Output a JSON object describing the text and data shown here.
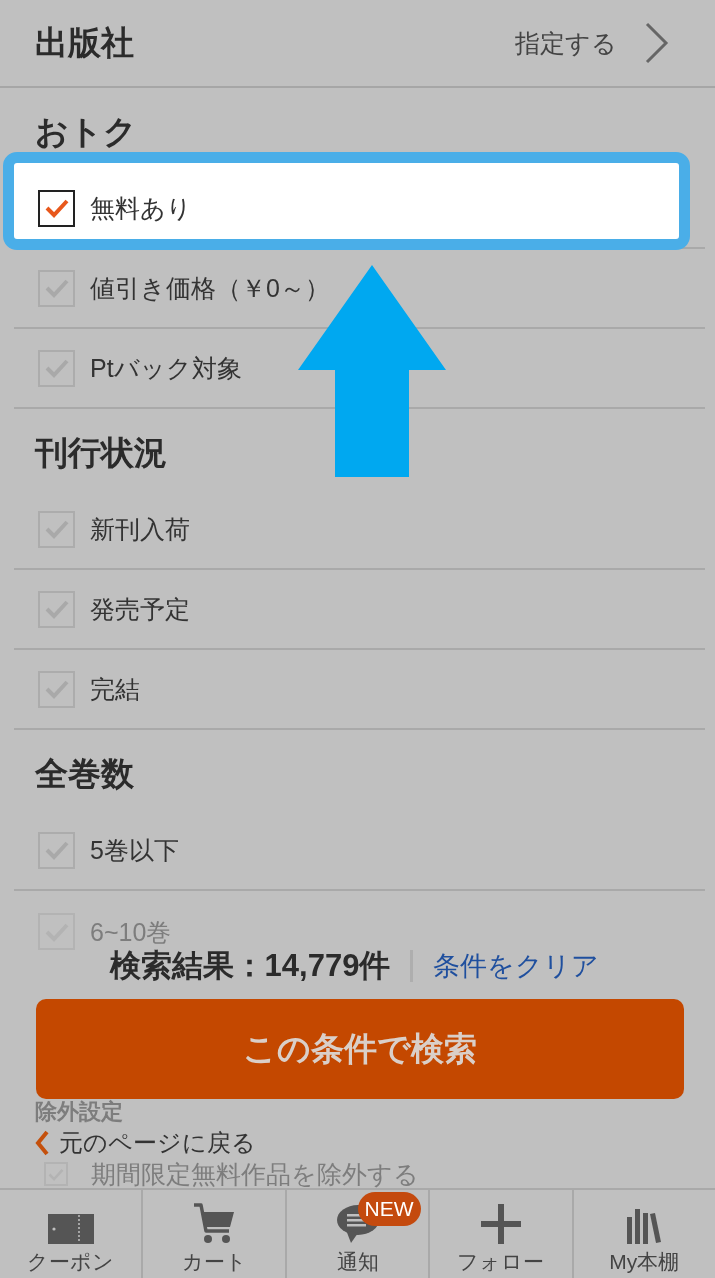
{
  "publisher_row": {
    "label": "出版社",
    "action": "指定する"
  },
  "sections": [
    {
      "heading": "おトク",
      "faded": false,
      "options": [
        {
          "label": "無料あり",
          "checked": true,
          "highlighted": true,
          "faded": false
        },
        {
          "label": "値引き価格（￥0～）",
          "checked": false,
          "highlighted": false,
          "faded": false
        },
        {
          "label": "Ptバック対象",
          "checked": false,
          "highlighted": false,
          "faded": false
        }
      ]
    },
    {
      "heading": "刊行状況",
      "faded": false,
      "options": [
        {
          "label": "新刊入荷",
          "checked": false,
          "highlighted": false,
          "faded": false
        },
        {
          "label": "発売予定",
          "checked": false,
          "highlighted": false,
          "faded": false
        },
        {
          "label": "完結",
          "checked": false,
          "highlighted": false,
          "faded": false
        }
      ]
    },
    {
      "heading": "全巻数",
      "faded": false,
      "options": [
        {
          "label": "5巻以下",
          "checked": false,
          "highlighted": false,
          "faded": false
        },
        {
          "label": "6~10巻",
          "checked": false,
          "highlighted": false,
          "faded": true
        }
      ]
    }
  ],
  "result": {
    "text": "検索結果：14,779件",
    "clear_link": "条件をクリア"
  },
  "search_button": "この条件で検索",
  "exclusion_section": {
    "heading": "除外設定",
    "faded": true
  },
  "back_link": "元のページに戻る",
  "exclusion_options": [
    {
      "label": "期間限定無料作品を除外する",
      "checked": false,
      "faded": true
    }
  ],
  "bottom_nav": [
    {
      "label": "クーポン"
    },
    {
      "label": "カート"
    },
    {
      "label": "通知",
      "badge": "NEW"
    },
    {
      "label": "フォロー"
    },
    {
      "label": "My本棚"
    }
  ]
}
